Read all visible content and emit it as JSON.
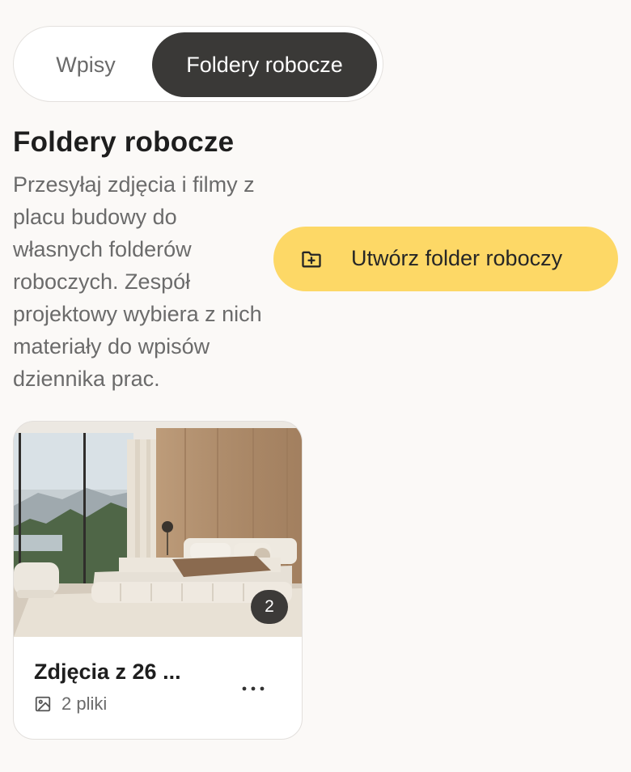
{
  "tabs": [
    {
      "label": "Wpisy",
      "active": false
    },
    {
      "label": "Foldery robocze",
      "active": true
    }
  ],
  "section": {
    "title": "Foldery robocze",
    "description": "Przesyłaj zdjęcia i filmy z placu budowy do własnych folderów roboczych. Zespół projektowy wybiera z nich materiały do wpisów dziennika prac."
  },
  "create_button": {
    "label": "Utwórz folder roboczy",
    "icon": "folder-plus-icon"
  },
  "folders": [
    {
      "title": "Zdjęcia z 26 ...",
      "meta": "2 pliki",
      "count_badge": "2",
      "meta_icon": "image-icon",
      "menu_icon": "more-horizontal-icon"
    }
  ],
  "colors": {
    "accent": "#fdd866",
    "active_tab": "#3a3937",
    "background": "#fbf9f7"
  }
}
